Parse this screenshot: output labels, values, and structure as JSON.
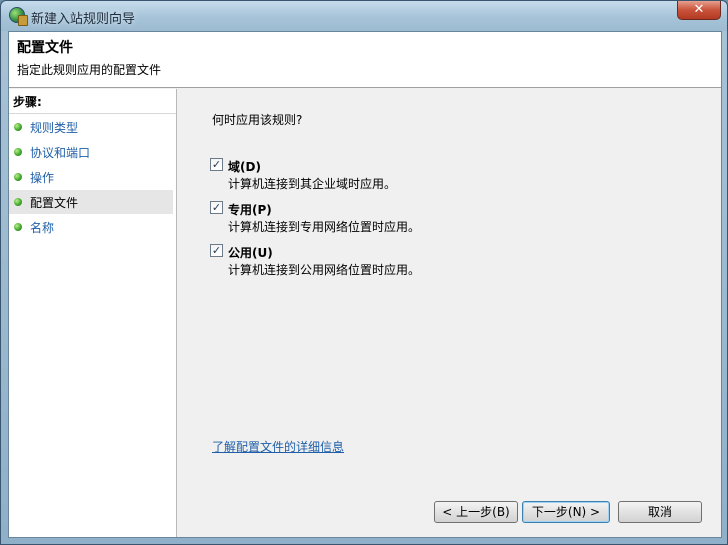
{
  "window": {
    "title": "新建入站规则向导",
    "close_label": "✕"
  },
  "header": {
    "title": "配置文件",
    "subtitle": "指定此规则应用的配置文件"
  },
  "sidebar": {
    "heading": "步骤:",
    "items": [
      {
        "label": "规则类型",
        "current": false
      },
      {
        "label": "协议和端口",
        "current": false
      },
      {
        "label": "操作",
        "current": false
      },
      {
        "label": "配置文件",
        "current": true
      },
      {
        "label": "名称",
        "current": false
      }
    ]
  },
  "main": {
    "question": "何时应用该规则?",
    "options": [
      {
        "label": "域(D)",
        "description": "计算机连接到其企业域时应用。",
        "checked": true
      },
      {
        "label": "专用(P)",
        "description": "计算机连接到专用网络位置时应用。",
        "checked": true
      },
      {
        "label": "公用(U)",
        "description": "计算机连接到公用网络位置时应用。",
        "checked": true
      }
    ],
    "learn_more_link": "了解配置文件的详细信息"
  },
  "buttons": {
    "back": "< 上一步(B)",
    "next": "下一步(N) >",
    "cancel": "取消"
  }
}
